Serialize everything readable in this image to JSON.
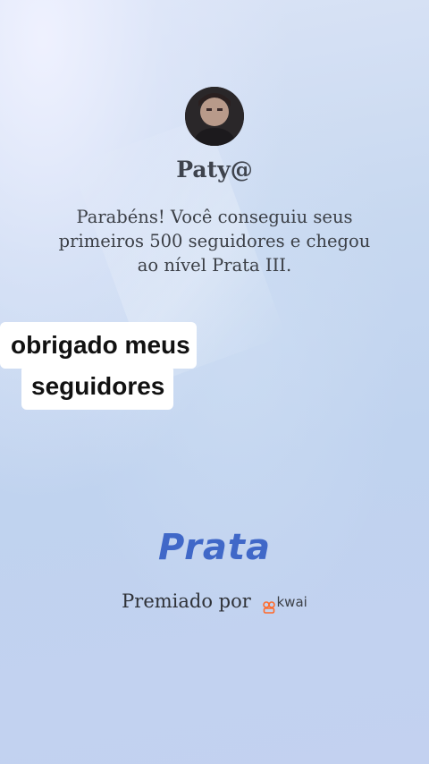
{
  "profile": {
    "username": "Paty@"
  },
  "message": {
    "text": "Parabéns! Você conseguiu seus primeiros 500 seguidores e chegou ao nível Prata III."
  },
  "caption": {
    "line1": "obrigado meus",
    "line2": "seguidores"
  },
  "level": {
    "name": "Prata",
    "color": "#4068c8"
  },
  "award": {
    "prefix": "Premiado por",
    "brand": "kwai",
    "brand_color": "#ff6a2b"
  }
}
